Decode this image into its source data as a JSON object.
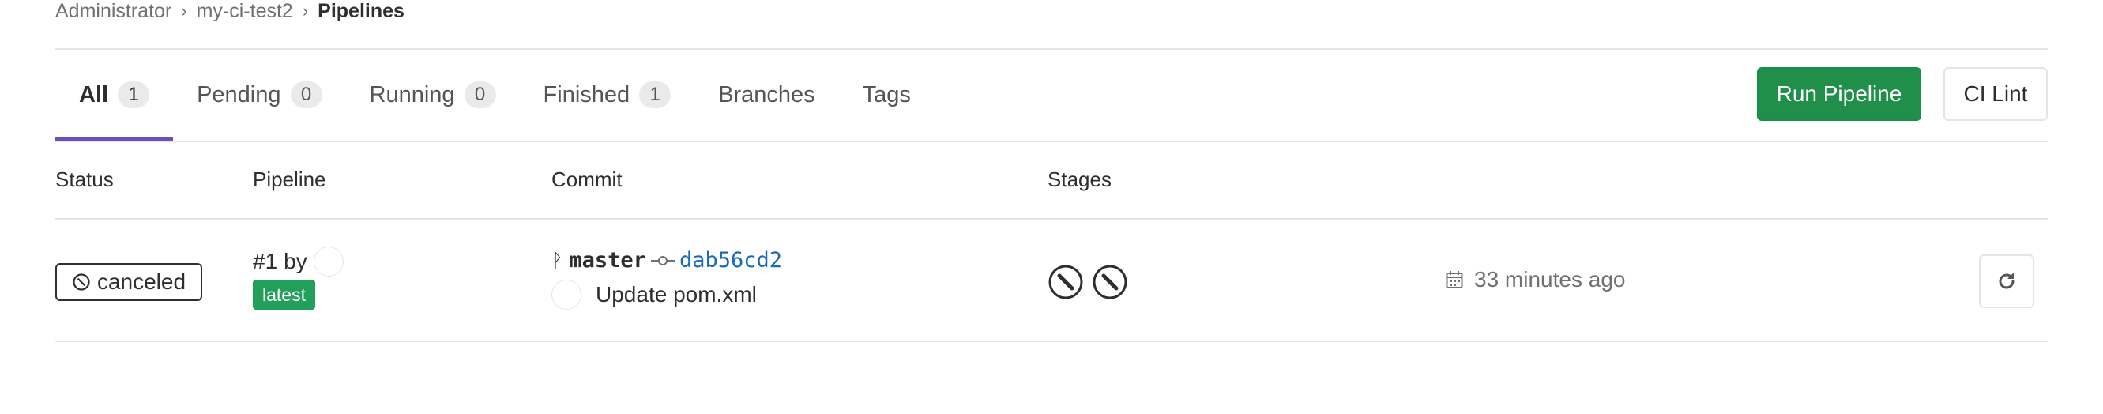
{
  "breadcrumb": {
    "items": [
      "Administrator",
      "my-ci-test2"
    ],
    "current": "Pipelines",
    "separator": "›"
  },
  "tabs": [
    {
      "label": "All",
      "count": "1",
      "active": true
    },
    {
      "label": "Pending",
      "count": "0"
    },
    {
      "label": "Running",
      "count": "0"
    },
    {
      "label": "Finished",
      "count": "1"
    },
    {
      "label": "Branches"
    },
    {
      "label": "Tags"
    }
  ],
  "actions": {
    "run_pipeline": "Run Pipeline",
    "ci_lint": "CI Lint"
  },
  "table": {
    "headers": {
      "status": "Status",
      "pipeline": "Pipeline",
      "commit": "Commit",
      "stages": "Stages"
    },
    "rows": [
      {
        "status": "canceled",
        "status_icon": "canceled-icon",
        "pipeline_id": "#1",
        "by": "by",
        "latest_label": "latest",
        "branch_icon": "ᚹ",
        "branch": "master",
        "commit_icon": "commit-icon",
        "sha": "dab56cd2",
        "commit_title": "Update pom.xml",
        "stages": [
          "canceled",
          "canceled"
        ],
        "time": "33 minutes ago",
        "time_icon": "calendar-icon",
        "retry_icon": "retry-icon"
      }
    ]
  },
  "colors": {
    "accent_tab": "#6b4fbb",
    "run_button": "#1f8f4a",
    "latest_badge": "#22a05b",
    "sha_link": "#1b69b6"
  }
}
